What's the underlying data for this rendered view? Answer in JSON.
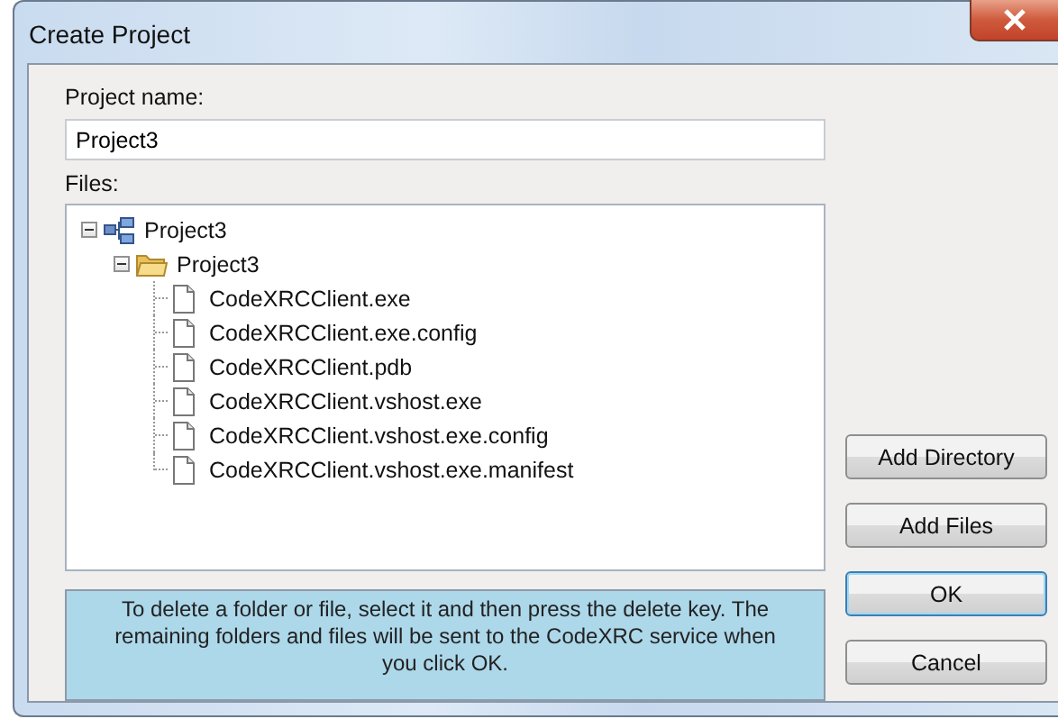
{
  "window": {
    "title": "Create Project"
  },
  "project_name": {
    "label": "Project name:",
    "value": "Project3"
  },
  "files": {
    "label": "Files:",
    "tree": [
      {
        "kind": "project",
        "label": "Project3",
        "expanded": true,
        "children": [
          {
            "kind": "folder",
            "label": "Project3",
            "expanded": true,
            "children": [
              {
                "kind": "file",
                "label": "CodeXRCClient.exe"
              },
              {
                "kind": "file",
                "label": "CodeXRCClient.exe.config"
              },
              {
                "kind": "file",
                "label": "CodeXRCClient.pdb"
              },
              {
                "kind": "file",
                "label": "CodeXRCClient.vshost.exe"
              },
              {
                "kind": "file",
                "label": "CodeXRCClient.vshost.exe.config"
              },
              {
                "kind": "file",
                "label": "CodeXRCClient.vshost.exe.manifest"
              }
            ]
          }
        ]
      }
    ]
  },
  "info": "To delete a folder or file, select it and then press the delete key. The remaining folders and files will be sent to the CodeXRC service when you click OK.",
  "buttons": [
    {
      "label": "Add Directory",
      "kind": "normal"
    },
    {
      "label": "Add Files",
      "kind": "normal"
    },
    {
      "label": "OK",
      "kind": "default"
    },
    {
      "label": "Cancel",
      "kind": "normal"
    }
  ]
}
